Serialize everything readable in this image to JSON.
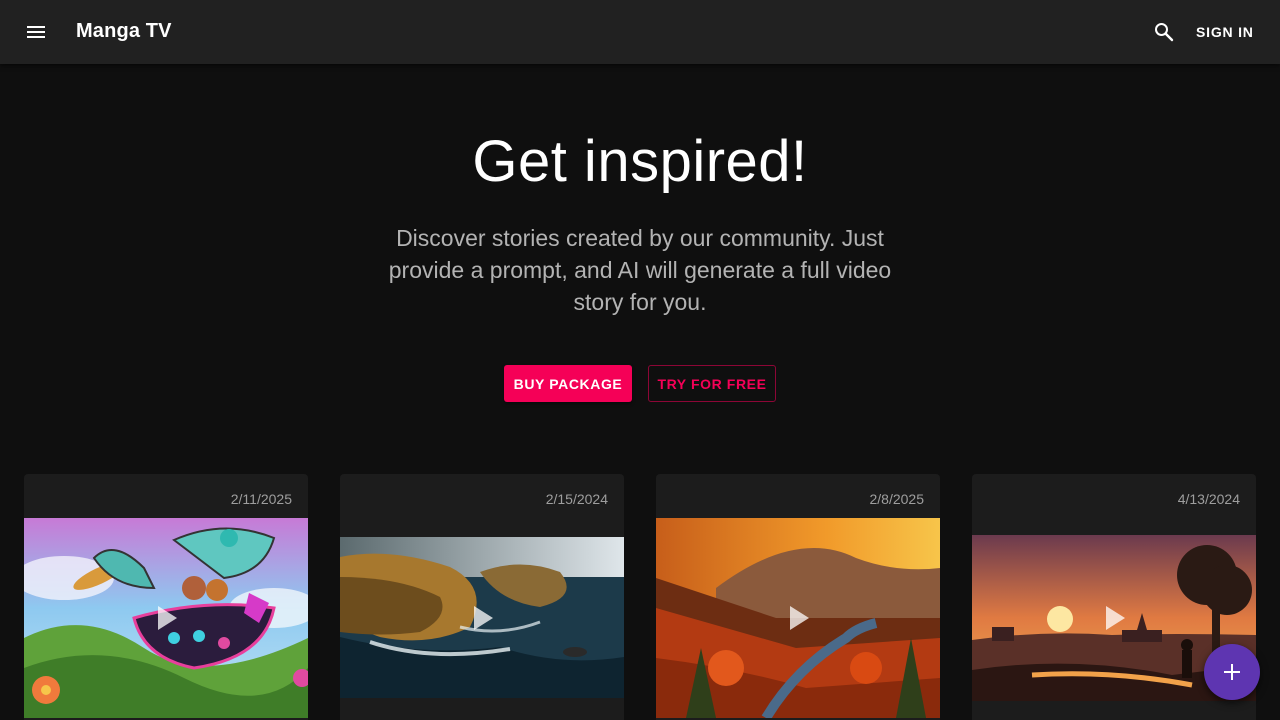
{
  "app": {
    "title": "Manga TV",
    "sign_in_label": "SIGN IN",
    "icons": {
      "menu": "menu-icon",
      "search": "search-icon",
      "add": "add-icon"
    }
  },
  "hero": {
    "title": "Get inspired!",
    "subtitle": "Discover stories created by our community. Just provide a prompt, and AI will generate a full video story for you.",
    "buy_label": "BUY PACKAGE",
    "try_label": "TRY FOR FREE"
  },
  "colors": {
    "accent": "#f50057",
    "fab": "#5e35b1",
    "appbar": "#212121",
    "background": "#0f0f0f"
  },
  "stories": [
    {
      "date": "2/11/2025",
      "thumbnail": "fantasy-flying-boat"
    },
    {
      "date": "2/15/2024",
      "thumbnail": "rocky-coastline"
    },
    {
      "date": "2/8/2025",
      "thumbnail": "autumn-forest-valley"
    },
    {
      "date": "4/13/2024",
      "thumbnail": "sunset-village"
    }
  ]
}
